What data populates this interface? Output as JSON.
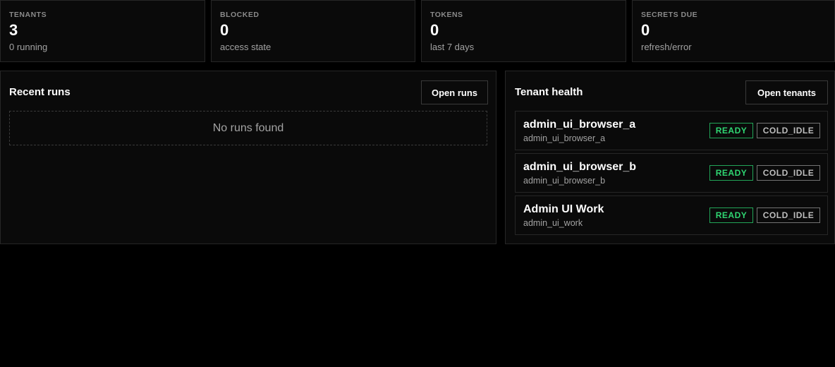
{
  "stats": [
    {
      "label": "TENANTS",
      "value": "3",
      "sub": "0 running"
    },
    {
      "label": "BLOCKED",
      "value": "0",
      "sub": "access state"
    },
    {
      "label": "TOKENS",
      "value": "0",
      "sub": "last 7 days"
    },
    {
      "label": "SECRETS DUE",
      "value": "0",
      "sub": "refresh/error"
    }
  ],
  "recent_runs": {
    "title": "Recent runs",
    "button": "Open runs",
    "empty": "No runs found"
  },
  "tenant_health": {
    "title": "Tenant health",
    "button": "Open tenants",
    "tenants": [
      {
        "name": "admin_ui_browser_a",
        "id": "admin_ui_browser_a",
        "status": "READY",
        "state": "COLD_IDLE"
      },
      {
        "name": "admin_ui_browser_b",
        "id": "admin_ui_browser_b",
        "status": "READY",
        "state": "COLD_IDLE"
      },
      {
        "name": "Admin UI Work",
        "id": "admin_ui_work",
        "status": "READY",
        "state": "COLD_IDLE"
      }
    ]
  },
  "colors": {
    "ready": "#2fd672",
    "cold_idle": "#bdbdbd",
    "background": "#000000",
    "panel": "#0a0a0a"
  }
}
